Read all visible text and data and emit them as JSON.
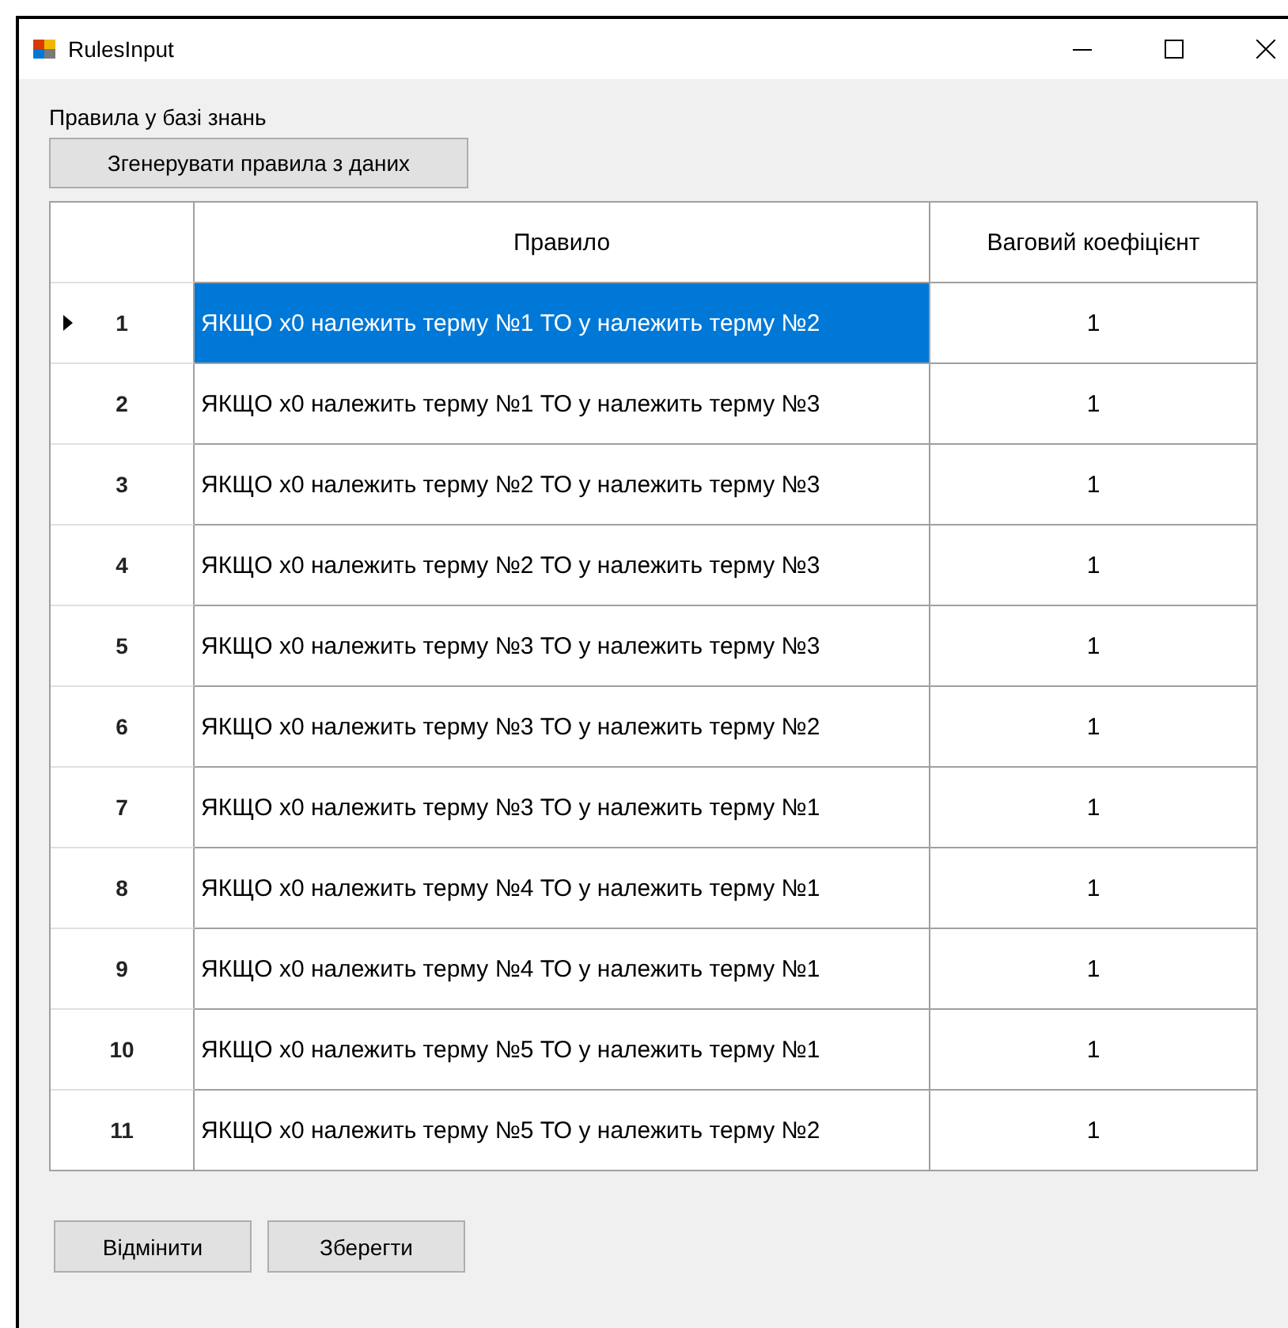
{
  "window": {
    "title": "RulesInput"
  },
  "label": "Правила у базі знань",
  "generate_button": "Згенерувати правила з даних",
  "table": {
    "columns": [
      "Правило",
      "Ваговий коефіцієнт"
    ],
    "rows": [
      {
        "number": "1",
        "rule": "ЯКЩО x0 належить терму №1 ТО у належить терму №2",
        "weight": "1",
        "selected": true
      },
      {
        "number": "2",
        "rule": "ЯКЩО x0 належить терму №1 ТО у належить терму №3",
        "weight": "1",
        "selected": false
      },
      {
        "number": "3",
        "rule": "ЯКЩО x0 належить терму №2 ТО у належить терму №3",
        "weight": "1",
        "selected": false
      },
      {
        "number": "4",
        "rule": "ЯКЩО x0 належить терму №2 ТО у належить терму №3",
        "weight": "1",
        "selected": false
      },
      {
        "number": "5",
        "rule": "ЯКЩО x0 належить терму №3 ТО у належить терму №3",
        "weight": "1",
        "selected": false
      },
      {
        "number": "6",
        "rule": "ЯКЩО x0 належить терму №3 ТО у належить терму №2",
        "weight": "1",
        "selected": false
      },
      {
        "number": "7",
        "rule": "ЯКЩО x0 належить терму №3 ТО у належить терму №1",
        "weight": "1",
        "selected": false
      },
      {
        "number": "8",
        "rule": "ЯКЩО x0 належить терму №4 ТО у належить терму №1",
        "weight": "1",
        "selected": false
      },
      {
        "number": "9",
        "rule": "ЯКЩО x0 належить терму №4 ТО у належить терму №1",
        "weight": "1",
        "selected": false
      },
      {
        "number": "10",
        "rule": "ЯКЩО x0 належить терму №5 ТО у належить терму №1",
        "weight": "1",
        "selected": false
      },
      {
        "number": "11",
        "rule": "ЯКЩО x0 належить терму №5 ТО у належить терму №2",
        "weight": "1",
        "selected": false
      }
    ]
  },
  "buttons": [
    "Відмінити",
    "Зберегти"
  ]
}
